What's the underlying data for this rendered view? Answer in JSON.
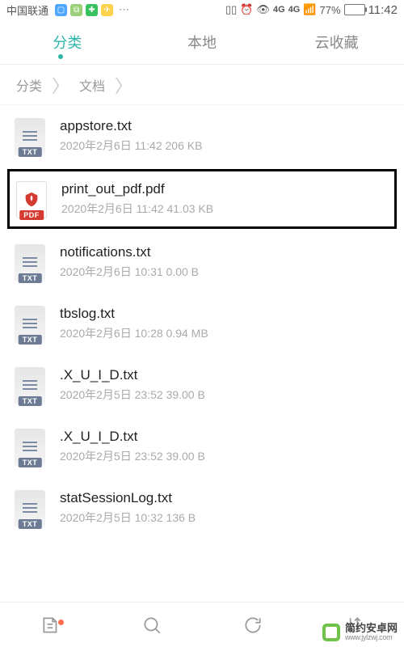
{
  "status": {
    "carrier": "中国联通",
    "signal_4g_a": "4G",
    "signal_4g_b": "4G",
    "battery_pct": "77%",
    "time": "11:42"
  },
  "tabs": {
    "items": [
      "分类",
      "本地",
      "云收藏"
    ],
    "active_index": 0
  },
  "breadcrumb": {
    "parts": [
      "分类",
      "文档"
    ]
  },
  "files": [
    {
      "name": "appstore.txt",
      "date": "2020年2月6日 11:42",
      "size": "206 KB",
      "type": "txt",
      "highlight": false
    },
    {
      "name": "print_out_pdf.pdf",
      "date": "2020年2月6日 11:42",
      "size": "41.03 KB",
      "type": "pdf",
      "highlight": true
    },
    {
      "name": "notifications.txt",
      "date": "2020年2月6日 10:31",
      "size": "0.00 B",
      "type": "txt",
      "highlight": false
    },
    {
      "name": "tbslog.txt",
      "date": "2020年2月6日 10:28",
      "size": "0.94 MB",
      "type": "txt",
      "highlight": false
    },
    {
      "name": ".X_U_I_D.txt",
      "date": "2020年2月5日 23:52",
      "size": "39.00 B",
      "type": "txt",
      "highlight": false
    },
    {
      "name": ".X_U_I_D.txt",
      "date": "2020年2月5日 23:52",
      "size": "39.00 B",
      "type": "txt",
      "highlight": false
    },
    {
      "name": "statSessionLog.txt",
      "date": "2020年2月5日 10:32",
      "size": "136 B",
      "type": "txt",
      "highlight": false
    }
  ],
  "icons": {
    "txt_badge": "TXT",
    "pdf_badge": "PDF"
  },
  "watermark": {
    "cn": "简约安卓网",
    "en": "www.jylzwj.com"
  }
}
